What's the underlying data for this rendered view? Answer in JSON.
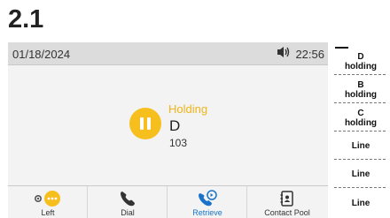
{
  "step": {
    "label": "2.1"
  },
  "status_bar": {
    "date": "01/18/2024",
    "time": "22:56",
    "volume_icon": "speaker-volume-icon"
  },
  "call": {
    "status": "Holding",
    "name": "D",
    "number": "103",
    "status_color": "#f0b51a",
    "icon": "pause-icon"
  },
  "softkeys": [
    {
      "label": "Left",
      "icon": "more-options-icon",
      "active": false
    },
    {
      "label": "Dial",
      "icon": "phone-handset-icon",
      "active": false
    },
    {
      "label": "Retrieve",
      "icon": "retrieve-call-icon",
      "active": true
    },
    {
      "label": "Contact Pool",
      "icon": "contact-book-icon",
      "active": false
    }
  ],
  "line_keys": [
    {
      "name": "D",
      "state": "holding"
    },
    {
      "name": "B",
      "state": "holding"
    },
    {
      "name": "C",
      "state": "holding"
    },
    {
      "name": "Line",
      "state": ""
    },
    {
      "name": "Line",
      "state": ""
    },
    {
      "name": "Line",
      "state": ""
    }
  ],
  "colors": {
    "accent_blue": "#1a73c8",
    "hold_yellow": "#f6bf1e"
  }
}
